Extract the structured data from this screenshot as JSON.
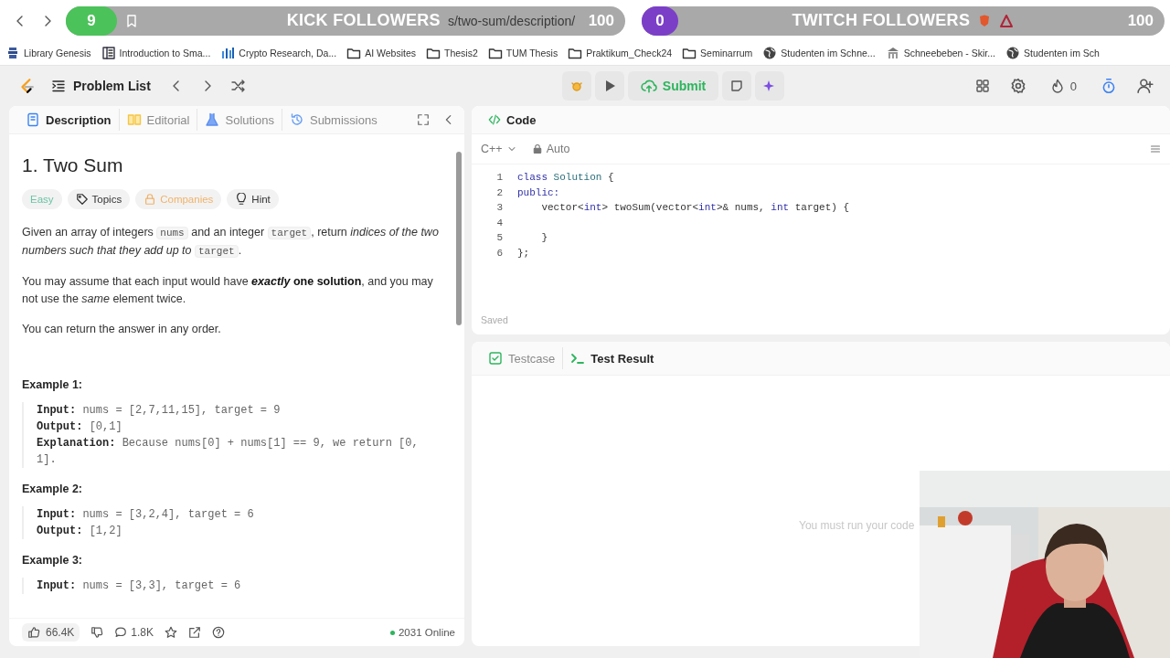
{
  "overlays": [
    {
      "kind": "kick",
      "count": "9",
      "title": "KICK FOLLOWERS",
      "goal": "100",
      "url_fragment": "s/two-sum/description/"
    },
    {
      "kind": "twitch",
      "count": "0",
      "title": "TWITCH FOLLOWERS",
      "goal": "100"
    }
  ],
  "bookmarks": [
    {
      "kind": "book",
      "label": "Library Genesis"
    },
    {
      "kind": "doc",
      "label": "Introduction to Sma..."
    },
    {
      "kind": "chart",
      "label": "Crypto Research, Da..."
    },
    {
      "kind": "folder",
      "label": "AI Websites"
    },
    {
      "kind": "folder",
      "label": "Thesis2"
    },
    {
      "kind": "folder",
      "label": "TUM Thesis"
    },
    {
      "kind": "folder",
      "label": "Praktikum_Check24"
    },
    {
      "kind": "folder",
      "label": "Seminarrum"
    },
    {
      "kind": "globe",
      "label": "Studenten im Schne..."
    },
    {
      "kind": "building",
      "label": "Schneebeben - Skir..."
    },
    {
      "kind": "globe",
      "label": "Studenten im Sch"
    }
  ],
  "navbar": {
    "problem_list": "Problem List",
    "submit": "Submit",
    "streak": "0"
  },
  "left_tabs": [
    {
      "kind": "doc",
      "label": "Description",
      "selected": true
    },
    {
      "kind": "book",
      "label": "Editorial",
      "selected": false
    },
    {
      "kind": "flask",
      "label": "Solutions",
      "selected": false
    },
    {
      "kind": "history",
      "label": "Submissions",
      "selected": false
    }
  ],
  "problem": {
    "title": "1. Two Sum",
    "tags": [
      {
        "kind": "difficulty",
        "label": "Easy"
      },
      {
        "kind": "tag",
        "label": "Topics"
      },
      {
        "kind": "lock",
        "label": "Companies"
      },
      {
        "kind": "bulb",
        "label": "Hint"
      }
    ],
    "paragraphs": [
      [
        {
          "kind": "text",
          "text": "Given an array of integers "
        },
        {
          "kind": "code",
          "text": "nums"
        },
        {
          "kind": "text",
          "text": " and an integer "
        },
        {
          "kind": "code",
          "text": "target"
        },
        {
          "kind": "text",
          "text": ", return "
        },
        {
          "kind": "italic",
          "text": "indices of the two numbers such that they add up to "
        },
        {
          "kind": "code",
          "text": "target"
        },
        {
          "kind": "text",
          "text": "."
        }
      ],
      [
        {
          "kind": "text",
          "text": "You may assume that each input would have "
        },
        {
          "kind": "bold_italic",
          "text": "exactly"
        },
        {
          "kind": "bold",
          "text": " one solution"
        },
        {
          "kind": "text",
          "text": ", and you may not use the "
        },
        {
          "kind": "italic",
          "text": "same"
        },
        {
          "kind": "text",
          "text": " element twice."
        }
      ],
      [
        {
          "kind": "text",
          "text": "You can return the answer in any order."
        }
      ]
    ],
    "examples": [
      {
        "title": "Example 1:",
        "lines": [
          {
            "label": "Input:",
            "value": "nums = [2,7,11,15], target = 9"
          },
          {
            "label": "Output:",
            "value": "[0,1]"
          },
          {
            "label": "Explanation:",
            "value": "Because nums[0] + nums[1] == 9, we return [0, 1]."
          }
        ]
      },
      {
        "title": "Example 2:",
        "lines": [
          {
            "label": "Input:",
            "value": "nums = [3,2,4], target = 6"
          },
          {
            "label": "Output:",
            "value": "[1,2]"
          }
        ]
      },
      {
        "title": "Example 3:",
        "lines": [
          {
            "label": "Input:",
            "value": "nums = [3,3], target = 6"
          }
        ]
      }
    ]
  },
  "footer": {
    "likes": "66.4K",
    "comments": "1.8K",
    "online": "2031 Online"
  },
  "editor": {
    "title": "Code",
    "language": "C++",
    "mode": "Auto",
    "status": "Saved",
    "lines": [
      {
        "number": "1",
        "tokens": [
          {
            "kind": "keyword",
            "text": "class"
          },
          {
            "kind": "type",
            "text": " Solution "
          },
          {
            "kind": "plain",
            "text": "{"
          }
        ]
      },
      {
        "number": "2",
        "tokens": [
          {
            "kind": "keyword",
            "text": "public:"
          }
        ]
      },
      {
        "number": "3",
        "tokens": [
          {
            "kind": "plain",
            "text": "    vector<"
          },
          {
            "kind": "keyword",
            "text": "int"
          },
          {
            "kind": "plain",
            "text": "> twoSum(vector<"
          },
          {
            "kind": "keyword",
            "text": "int"
          },
          {
            "kind": "plain",
            "text": ">& nums, "
          },
          {
            "kind": "keyword",
            "text": "int"
          },
          {
            "kind": "plain",
            "text": " target) {"
          }
        ]
      },
      {
        "number": "4"
      },
      {
        "number": "5",
        "tokens": [
          {
            "kind": "plain",
            "text": "    }"
          }
        ]
      },
      {
        "number": "6",
        "tokens": [
          {
            "kind": "plain",
            "text": "};"
          }
        ]
      }
    ]
  },
  "bottom_tabs": [
    {
      "kind": "check",
      "label": "Testcase",
      "selected": false
    },
    {
      "kind": "terminal",
      "label": "Test Result",
      "selected": true
    }
  ],
  "result_message": "You must run your code"
}
